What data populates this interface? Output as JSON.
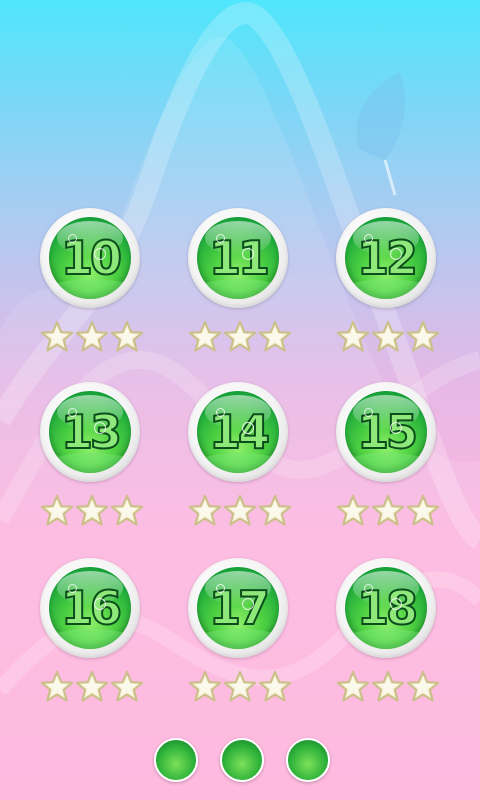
{
  "levels": [
    {
      "number": "10",
      "stars_earned": 0,
      "stars_total": 3
    },
    {
      "number": "11",
      "stars_earned": 0,
      "stars_total": 3
    },
    {
      "number": "12",
      "stars_earned": 0,
      "stars_total": 3
    },
    {
      "number": "13",
      "stars_earned": 0,
      "stars_total": 3
    },
    {
      "number": "14",
      "stars_earned": 0,
      "stars_total": 3
    },
    {
      "number": "15",
      "stars_earned": 0,
      "stars_total": 3
    },
    {
      "number": "16",
      "stars_earned": 0,
      "stars_total": 3
    },
    {
      "number": "17",
      "stars_earned": 0,
      "stars_total": 3
    },
    {
      "number": "18",
      "stars_earned": 0,
      "stars_total": 3
    }
  ],
  "pager": {
    "pages": 3
  },
  "colors": {
    "star_fill": "#f7f2d6",
    "star_stroke": "#cbbf8c",
    "orb_green": "#2fb33a",
    "number_outline": "#0b4d1c"
  },
  "icons": {
    "star": "star-icon",
    "page_dot": "page-dot-icon"
  }
}
